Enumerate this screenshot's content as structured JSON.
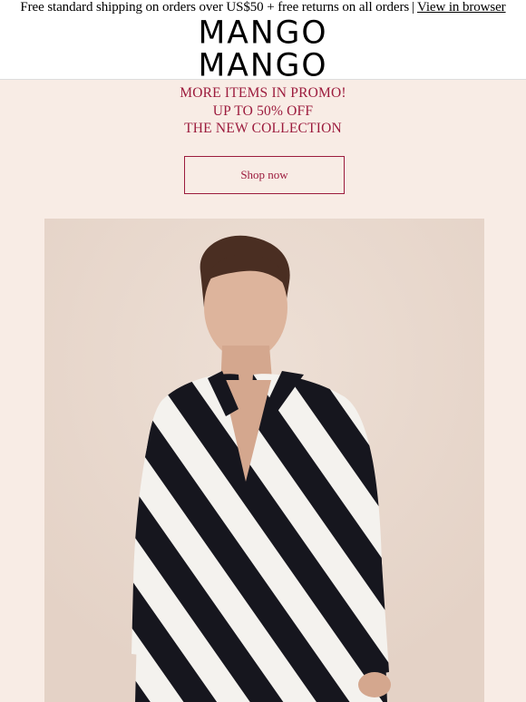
{
  "topbar": {
    "shipping_text": "Free standard shipping on orders over US$50 + free returns on all orders",
    "separator": "|",
    "view_in_browser": "View in browser"
  },
  "logo": {
    "line1": "MANGO",
    "line2": "MANGO"
  },
  "promo": {
    "line1": "MORE ITEMS IN PROMO!",
    "line2": "UP TO 50% OFF",
    "line3": "THE NEW COLLECTION",
    "shop_now": "Shop now"
  },
  "colors": {
    "accent": "#9c1b3d",
    "promo_bg": "#f8ece5",
    "hero_bg": "#e9d9ce"
  },
  "hero": {
    "image": "model-in-black-white-striped-wrap-dress"
  }
}
